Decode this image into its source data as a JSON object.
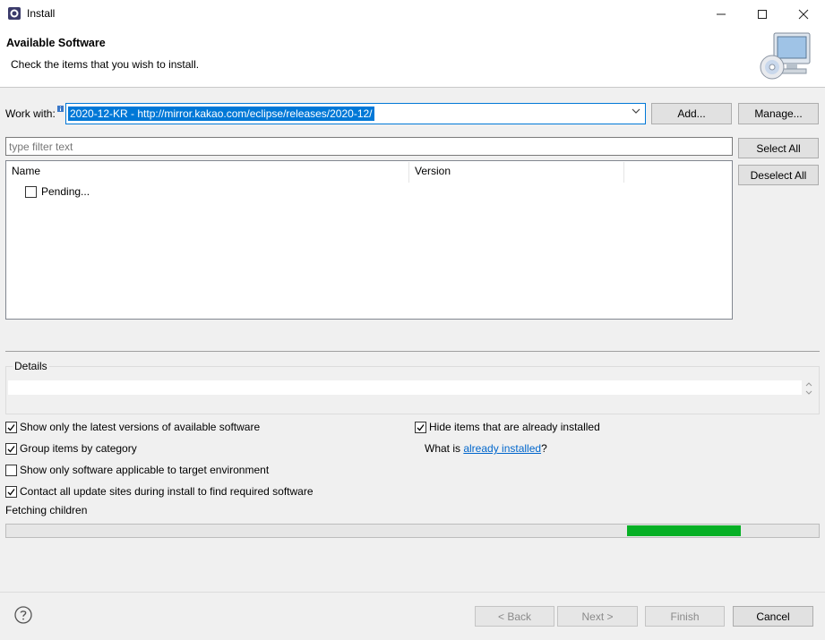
{
  "window": {
    "title": "Install",
    "minimize_icon": "minimize-icon",
    "maximize_icon": "maximize-icon",
    "close_icon": "close-icon"
  },
  "header": {
    "title": "Available Software",
    "subtitle": "Check the items that you wish to install.",
    "image": "install-computer-cd-icon"
  },
  "work_with": {
    "label": "Work with:",
    "value": "2020-12-KR - http://mirror.kakao.com/eclipse/releases/2020-12/",
    "add_label": "Add...",
    "manage_label": "Manage..."
  },
  "filter": {
    "placeholder": "type filter text"
  },
  "table": {
    "columns": [
      "Name",
      "Version"
    ],
    "rows": [
      {
        "name": "Pending...",
        "checked": false
      }
    ]
  },
  "side_buttons": {
    "select_all": "Select All",
    "deselect_all": "Deselect All"
  },
  "details": {
    "label": "Details",
    "text": ""
  },
  "options": {
    "show_latest": {
      "label": "Show only the latest versions of available software",
      "checked": true
    },
    "group_by_category": {
      "label": "Group items by category",
      "checked": true
    },
    "show_applicable": {
      "label": "Show only software applicable to target environment",
      "checked": false
    },
    "contact_all": {
      "label": "Contact all update sites during install to find required software",
      "checked": true
    },
    "hide_installed": {
      "label": "Hide items that are already installed",
      "checked": true
    },
    "what_is_prefix": "What is ",
    "what_is_link": "already installed",
    "what_is_suffix": "?"
  },
  "status": {
    "text": "Fetching children",
    "progress_start": 0.764,
    "progress_fill": 0.14,
    "progress_color": "#06b025"
  },
  "footer": {
    "help_icon": "help-icon",
    "back_label": "< Back",
    "next_label": "Next >",
    "finish_label": "Finish",
    "cancel_label": "Cancel"
  },
  "colors": {
    "selection": "#0078d7",
    "link": "#0066cc"
  }
}
